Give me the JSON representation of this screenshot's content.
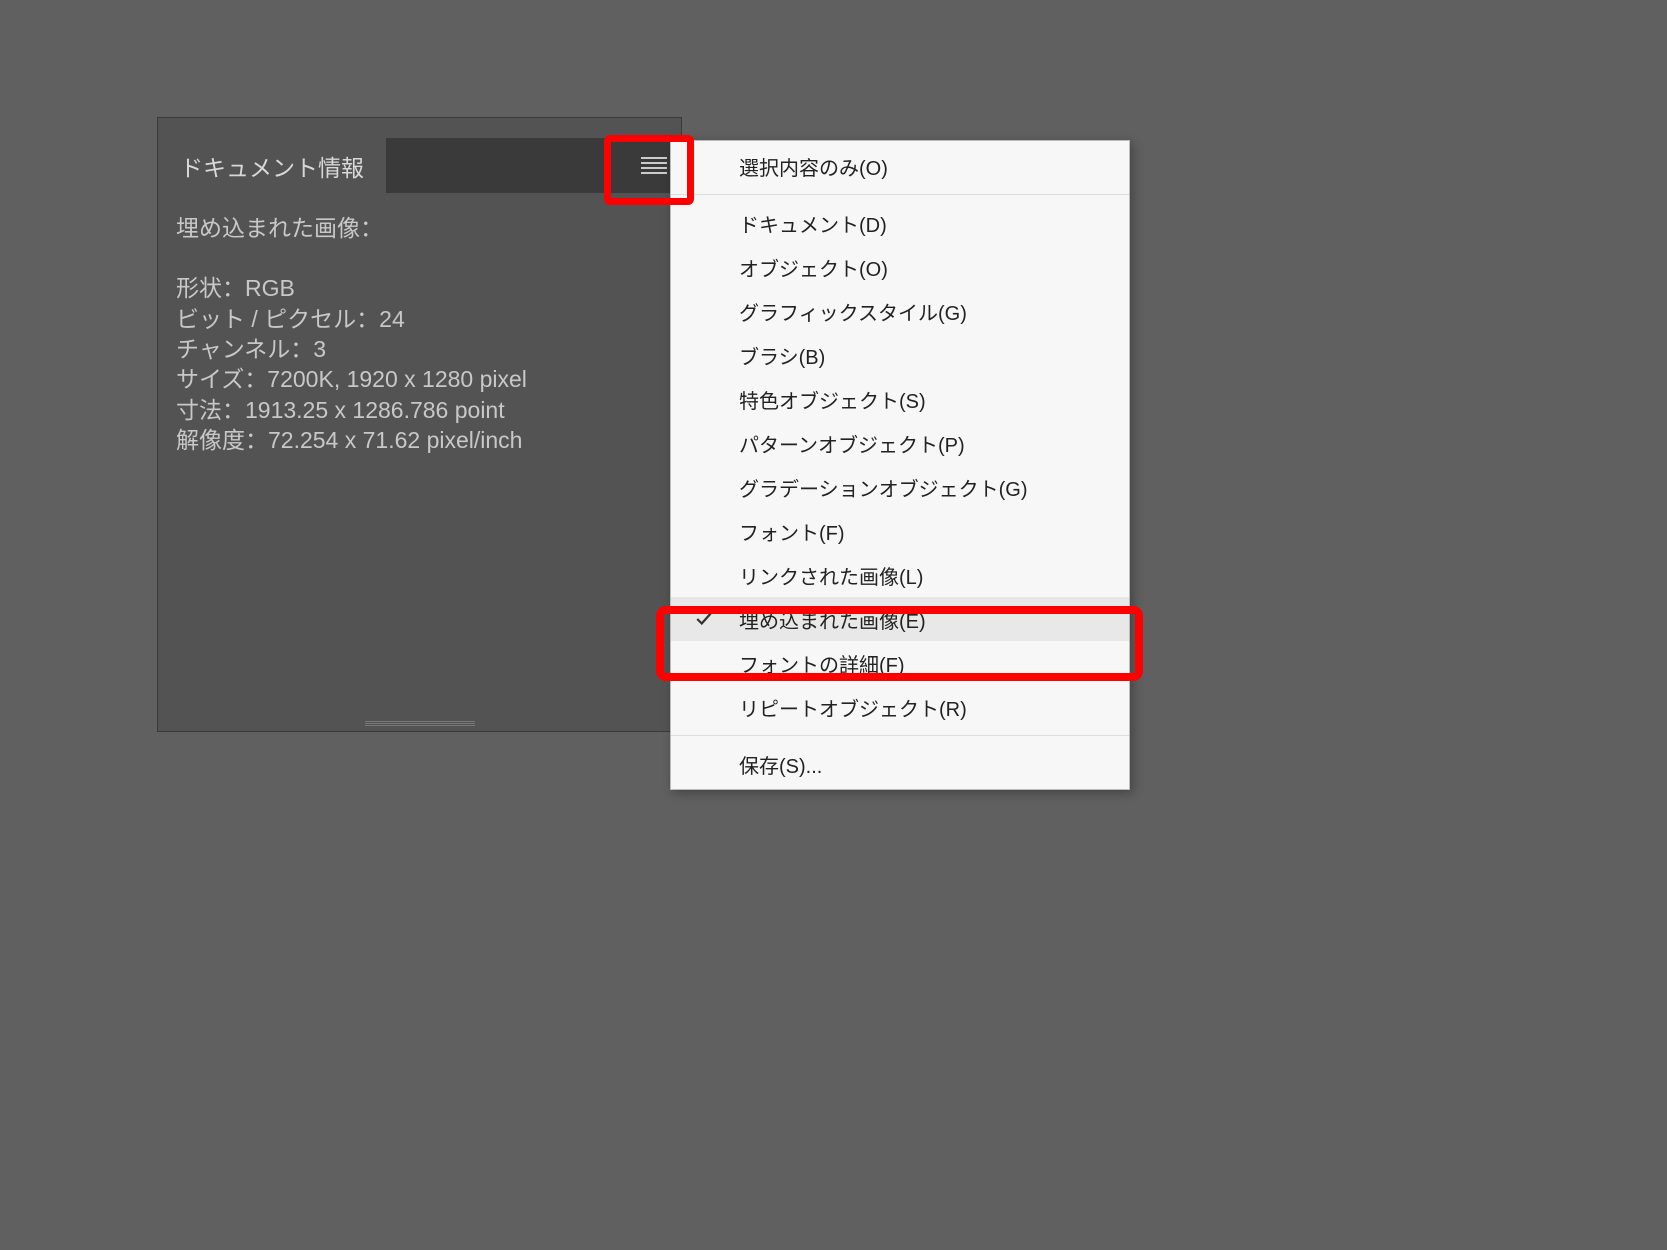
{
  "panel": {
    "tab_title": "ドキュメント情報",
    "content": {
      "header": "埋め込まれた画像：",
      "lines": [
        "形状：RGB",
        "ビット / ピクセル：24",
        "チャンネル：3",
        "サイズ：7200K, 1920 x 1280 pixel",
        "寸法：1913.25 x 1286.786 point",
        "解像度：72.254 x 71.62 pixel/inch"
      ]
    }
  },
  "menu": {
    "group1": [
      "選択内容のみ(O)"
    ],
    "group2": [
      "ドキュメント(D)",
      "オブジェクト(O)",
      "グラフィックスタイル(G)",
      "ブラシ(B)",
      "特色オブジェクト(S)",
      "パターンオブジェクト(P)",
      "グラデーションオブジェクト(G)",
      "フォント(F)",
      "リンクされた画像(L)",
      "埋め込まれた画像(E)",
      "フォントの詳細(F)",
      "リピートオブジェクト(R)"
    ],
    "group3": [
      "保存(S)..."
    ],
    "selected_index": 9
  }
}
